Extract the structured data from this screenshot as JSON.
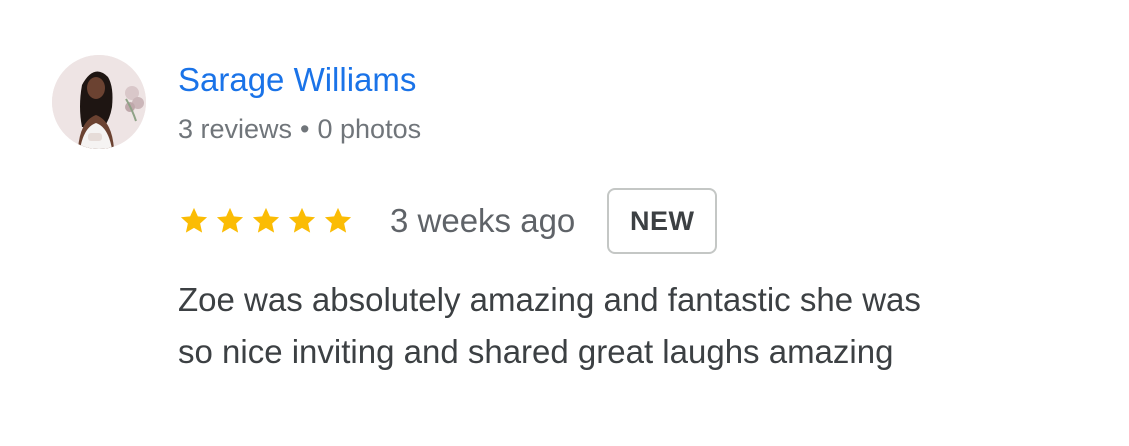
{
  "reviewer": {
    "name": "Sarage Williams",
    "reviews": "3 reviews",
    "separator": "•",
    "photos": "0 photos",
    "avatar_icon": "profile-photo"
  },
  "review": {
    "rating": 5,
    "rating_max": 5,
    "star_color": "#fbbc04",
    "time": "3 weeks ago",
    "badge": "NEW",
    "text_lines": [
      "Zoe was absolutely amazing and fantastic she was",
      "so nice inviting and shared great laughs amazing"
    ]
  },
  "colors": {
    "name": "#1a73e8",
    "meta": "#70757a",
    "text": "#3c4043"
  }
}
